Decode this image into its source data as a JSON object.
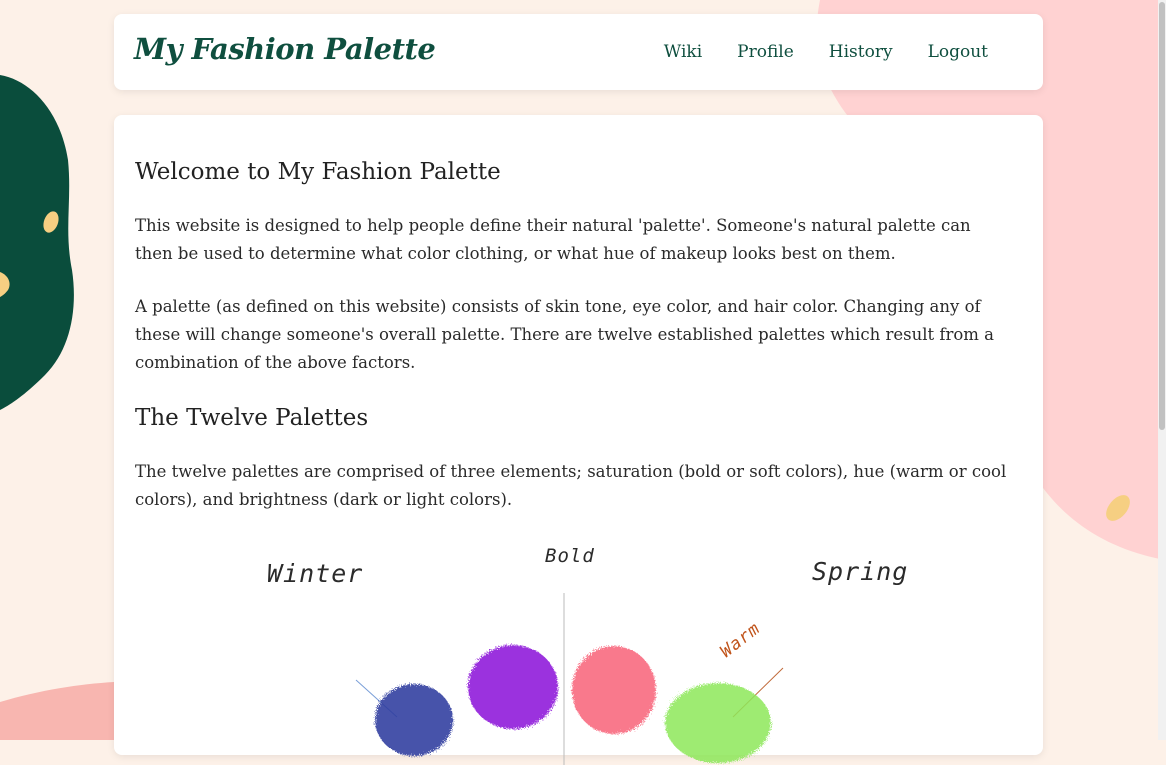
{
  "navbar": {
    "brand": "My Fashion Palette",
    "links": [
      "Wiki",
      "Profile",
      "History",
      "Logout"
    ]
  },
  "main": {
    "welcome_heading": "Welcome to My Fashion Palette",
    "intro_paragraph": "This website is designed to help people define their natural 'palette'. Someone's natural palette can then be used to determine what color clothing, or what hue of makeup looks best on them.",
    "palette_paragraph": "A palette (as defined on this website) consists of skin tone, eye color, and hair color. Changing any of these will change someone's overall palette. There are twelve established palettes which result from a combination of the above factors.",
    "twelve_heading": "The Twelve Palettes",
    "twelve_paragraph": "The twelve palettes are comprised of three elements; saturation (bold or soft colors), hue (warm or cool colors), and brightness (dark or light colors)."
  },
  "diagram": {
    "labels": {
      "winter": "Winter",
      "bold": "Bold",
      "spring": "Spring",
      "warm": "Warm"
    },
    "blob_colors": {
      "navy": "#2f3c9e",
      "purple": "#8a12d8",
      "pink": "#f85a74",
      "green": "#8de85a"
    }
  },
  "colors": {
    "brand_green": "#0f4f3f",
    "page_bg": "#fdf1e8",
    "pink_shape": "#ffd2d2",
    "gold_accent": "#f6cf82"
  }
}
